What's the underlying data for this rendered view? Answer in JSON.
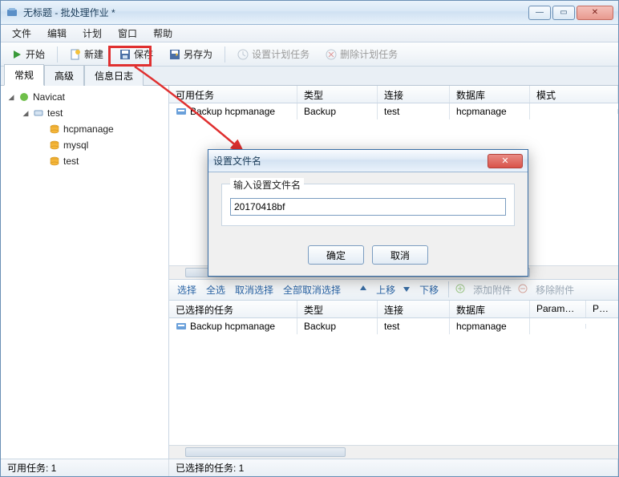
{
  "window": {
    "title": "无标题 - 批处理作业 *"
  },
  "sys_buttons": {
    "min": "—",
    "max": "▭",
    "close": "✕"
  },
  "menu": {
    "file": "文件",
    "edit": "编辑",
    "plan": "计划",
    "window": "窗口",
    "help": "帮助"
  },
  "toolbar": {
    "start": "开始",
    "new": "新建",
    "save": "保存",
    "save_as": "另存为",
    "set_plan": "设置计划任务",
    "del_plan": "删除计划任务"
  },
  "tabs": {
    "general": "常规",
    "advanced": "高级",
    "log": "信息日志"
  },
  "tree": {
    "root": "Navicat",
    "conn": "test",
    "db1": "hcpmanage",
    "db2": "mysql",
    "db3": "test"
  },
  "top_list": {
    "headers": {
      "task": "可用任务",
      "type": "类型",
      "conn": "连接",
      "db": "数据库",
      "schema": "模式"
    },
    "row": {
      "task": "Backup hcpmanage",
      "type": "Backup",
      "conn": "test",
      "db": "hcpmanage"
    }
  },
  "mid_toolbar": {
    "select": "选择",
    "select_all": "全选",
    "deselect": "取消选择",
    "deselect_all": "全部取消选择",
    "move_up": "上移",
    "move_down": "下移",
    "add_attach": "添加附件",
    "remove_attach": "移除附件"
  },
  "bottom_list": {
    "headers": {
      "task": "已选择的任务",
      "type": "类型",
      "conn": "连接",
      "db": "数据库",
      "params": "Paramet...",
      "extra": "Para"
    },
    "row": {
      "task": "Backup hcpmanage",
      "type": "Backup",
      "conn": "test",
      "db": "hcpmanage"
    }
  },
  "status": {
    "left": "可用任务: 1",
    "right": "已选择的任务: 1"
  },
  "dialog": {
    "title": "设置文件名",
    "label": "输入设置文件名",
    "value": "20170418bf",
    "ok": "确定",
    "cancel": "取消",
    "close": "✕"
  }
}
